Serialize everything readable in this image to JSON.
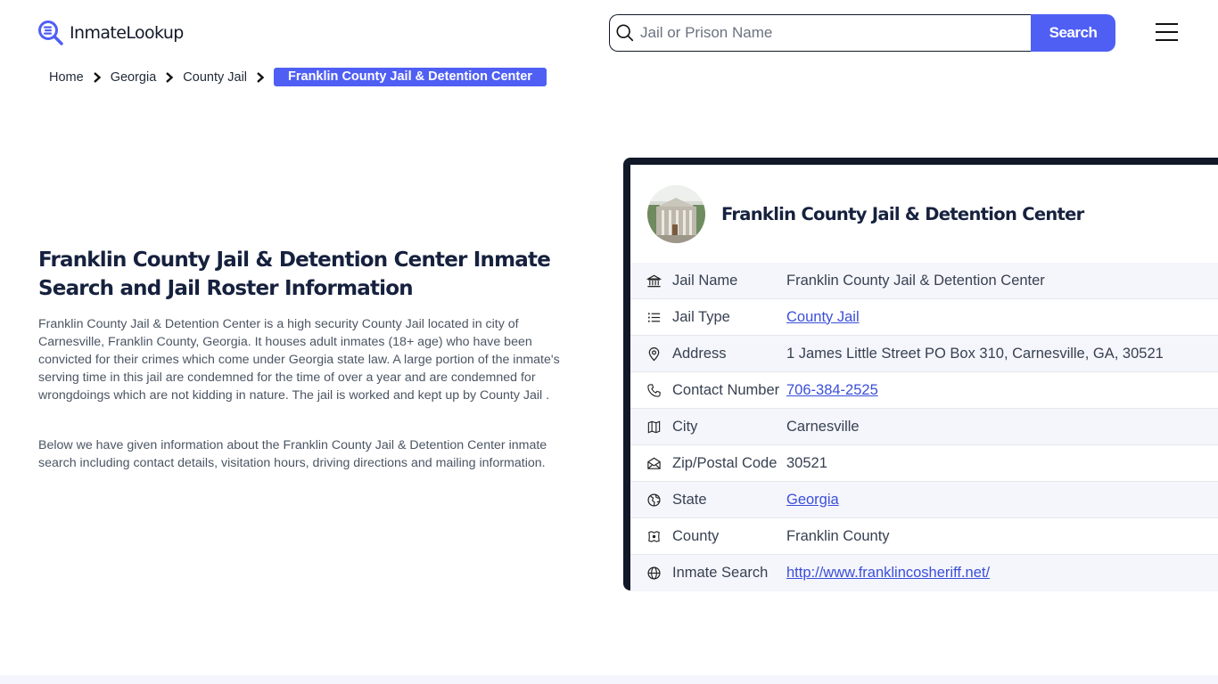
{
  "header": {
    "logo_text": "InmateLookup",
    "search": {
      "placeholder": "Jail or Prison Name",
      "value": "",
      "button_label": "Search"
    },
    "menu_icon": "hamburger-icon"
  },
  "breadcrumb": {
    "items": [
      {
        "label": "Home"
      },
      {
        "label": "Georgia"
      },
      {
        "label": "County Jail"
      }
    ],
    "current": "Franklin County Jail & Detention Center"
  },
  "main": {
    "title": "Franklin County Jail & Detention Center Inmate Search and Jail Roster Information",
    "paragraphs": [
      "Franklin County Jail & Detention Center is a high security County Jail located in city of Carnesville, Franklin County, Georgia. It houses adult inmates (18+ age) who have been convicted for their crimes which come under Georgia state law. A large portion of the inmate's serving time in this jail are condemned for the time of over a year and are condemned for wrongdoings which are not kidding in nature. The jail is worked and kept up by County Jail .",
      "Below we have given information about the Franklin County Jail & Detention Center inmate search including contact details, visitation hours, driving directions and mailing information."
    ]
  },
  "card": {
    "title": "Franklin County Jail & Detention Center",
    "photo_alt": "facility-photo",
    "rows": [
      {
        "icon": "building-icon",
        "label": "Jail Name",
        "value": "Franklin County Jail & Detention Center",
        "link": false
      },
      {
        "icon": "list-icon",
        "label": "Jail Type",
        "value": "County Jail",
        "link": true
      },
      {
        "icon": "map-pin-icon",
        "label": "Address",
        "value": "1 James Little Street PO Box 310, Carnesville, GA, 30521",
        "link": false
      },
      {
        "icon": "phone-icon",
        "label": "Contact Number",
        "value": "706-384-2525",
        "link": true
      },
      {
        "icon": "map-icon",
        "label": "City",
        "value": "Carnesville",
        "link": false
      },
      {
        "icon": "mail-icon",
        "label": "Zip/Postal Code",
        "value": "30521",
        "link": false
      },
      {
        "icon": "globe-region-icon",
        "label": "State",
        "value": "Georgia",
        "link": true
      },
      {
        "icon": "county-map-icon",
        "label": "County",
        "value": "Franklin County",
        "link": false
      },
      {
        "icon": "globe-icon",
        "label": "Inmate Search",
        "value": "http://www.franklincosheriff.net/",
        "link": true
      }
    ]
  },
  "colors": {
    "accent": "#4f5ff4",
    "card_border": "#111827",
    "link": "#3b4fd8",
    "title": "#16213e",
    "row_alt_bg": "#f5f6fc"
  }
}
